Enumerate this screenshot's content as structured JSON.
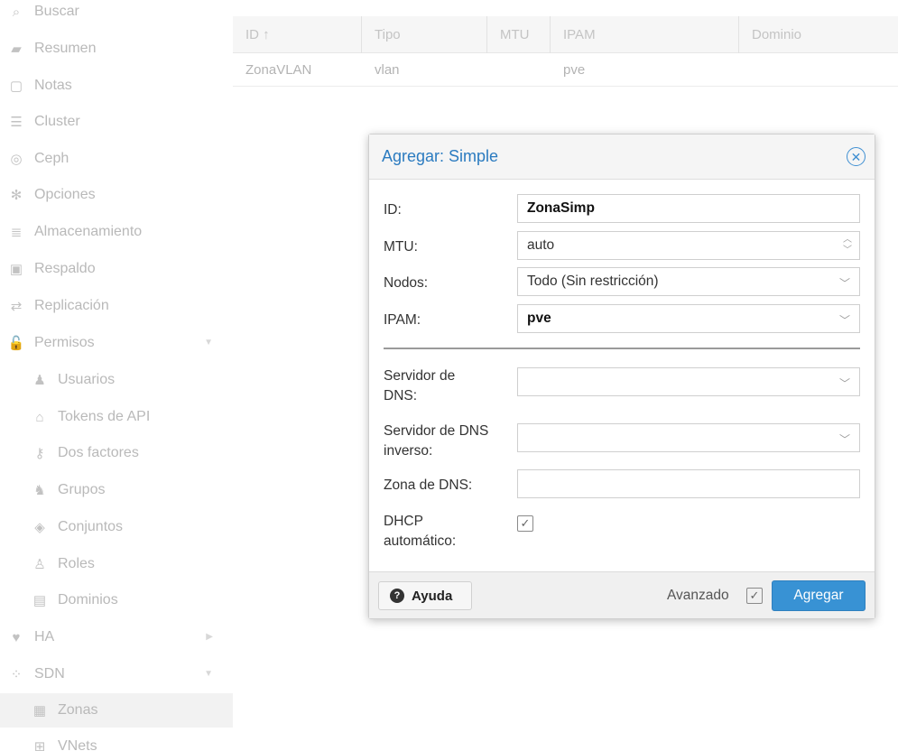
{
  "sidebar": {
    "items": [
      {
        "label": "Buscar",
        "icon": "search-icon",
        "glyph": "⌕"
      },
      {
        "label": "Resumen",
        "icon": "book-icon",
        "glyph": "▰"
      },
      {
        "label": "Notas",
        "icon": "note-icon",
        "glyph": "▢"
      },
      {
        "label": "Cluster",
        "icon": "server-icon",
        "glyph": "☰"
      },
      {
        "label": "Ceph",
        "icon": "ceph-icon",
        "glyph": "◎"
      },
      {
        "label": "Opciones",
        "icon": "gear-icon",
        "glyph": "✻"
      },
      {
        "label": "Almacenamiento",
        "icon": "database-icon",
        "glyph": "≣"
      },
      {
        "label": "Respaldo",
        "icon": "floppy-icon",
        "glyph": "▣"
      },
      {
        "label": "Replicación",
        "icon": "retweet-icon",
        "glyph": "⇄"
      },
      {
        "label": "Permisos",
        "icon": "unlock-icon",
        "glyph": "🔓"
      },
      {
        "label": "Usuarios",
        "icon": "user-icon",
        "glyph": "♟"
      },
      {
        "label": "Tokens de API",
        "icon": "user-outline-icon",
        "glyph": "⌂"
      },
      {
        "label": "Dos factores",
        "icon": "key-icon",
        "glyph": "⚷"
      },
      {
        "label": "Grupos",
        "icon": "users-icon",
        "glyph": "♞"
      },
      {
        "label": "Conjuntos",
        "icon": "tags-icon",
        "glyph": "◈"
      },
      {
        "label": "Roles",
        "icon": "male-icon",
        "glyph": "♙"
      },
      {
        "label": "Dominios",
        "icon": "address-book-icon",
        "glyph": "▤"
      },
      {
        "label": "HA",
        "icon": "heartbeat-icon",
        "glyph": "♥"
      },
      {
        "label": "SDN",
        "icon": "sdn-icon",
        "glyph": "⁘"
      },
      {
        "label": "Zonas",
        "icon": "th-icon",
        "glyph": "▦"
      },
      {
        "label": "VNets",
        "icon": "network-icon",
        "glyph": "⊞"
      }
    ]
  },
  "grid": {
    "columns": [
      "ID ↑",
      "Tipo",
      "MTU",
      "IPAM",
      "Dominio"
    ],
    "rows": [
      {
        "id": "ZonaVLAN",
        "type": "vlan",
        "mtu": "",
        "ipam": "pve",
        "domain": ""
      }
    ]
  },
  "dialog": {
    "title": "Agregar: Simple",
    "fields": {
      "id": {
        "label": "ID:",
        "value": "ZonaSimp"
      },
      "mtu": {
        "label": "MTU:",
        "value": "auto"
      },
      "nodes": {
        "label": "Nodos:",
        "value": "Todo (Sin restricción)"
      },
      "ipam": {
        "label": "IPAM:",
        "value": "pve"
      },
      "dns": {
        "label_line1": "Servidor de",
        "label_line2": "DNS:",
        "value": ""
      },
      "reverse_dns": {
        "label_line1": "Servidor de DNS",
        "label_line2": "inverso:",
        "value": ""
      },
      "dns_zone": {
        "label": "Zona de DNS:",
        "value": ""
      },
      "auto_dhcp": {
        "label_line1": "DHCP",
        "label_line2": "automático:",
        "checked": true
      }
    },
    "footer": {
      "help_label": "Ayuda",
      "advanced_label": "Avanzado",
      "advanced_checked": true,
      "submit_label": "Agregar"
    }
  },
  "colors": {
    "accent": "#3892d4",
    "title": "#2b7bc0",
    "sidebar_text": "#b9b9b9"
  }
}
